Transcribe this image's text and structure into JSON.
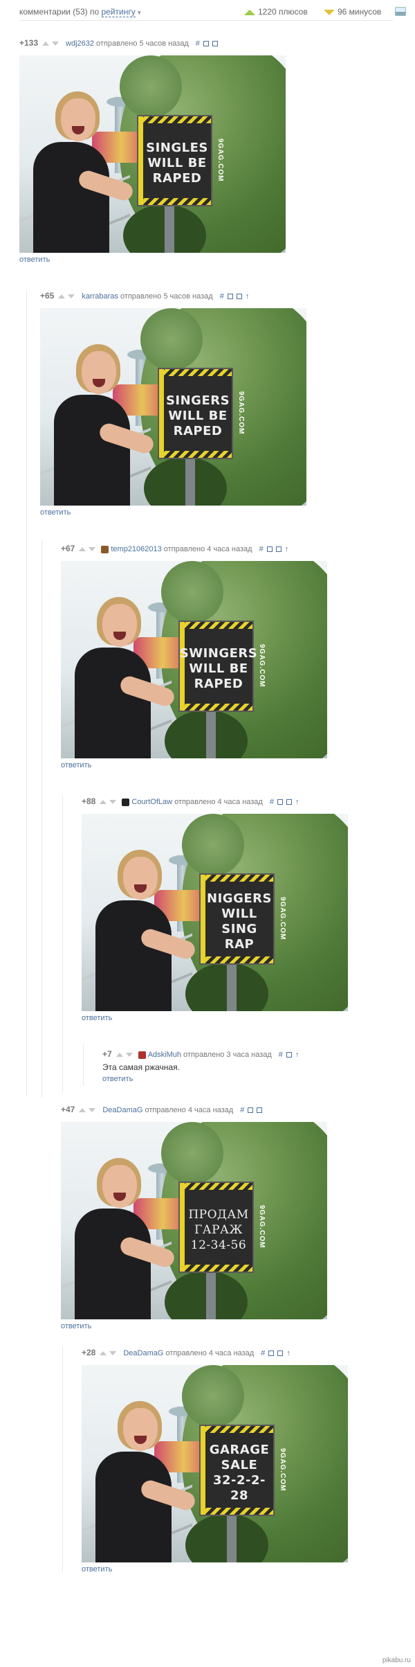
{
  "sort_bar": {
    "prefix": "комментарии (53) по",
    "sort_label": "рейтингу",
    "caret": "▾",
    "plus_text": "1220 плюсов",
    "minus_text": "96 минусов"
  },
  "common": {
    "sent": "отправлено",
    "reply": "ответить",
    "tools": "#",
    "arrow": "↑"
  },
  "comments": [
    {
      "rating": "+133",
      "author": "wdj2632",
      "time": "5 часов назад",
      "sign": [
        "SINGLES",
        "WILL BE",
        "RAPED"
      ],
      "watermark": "9GAG.COM",
      "avatar_color": ""
    },
    {
      "rating": "+65",
      "author": "karrabaras",
      "time": "5 часов назад",
      "sign": [
        "SINGERS",
        "WILL BE",
        "RAPED"
      ],
      "watermark": "9GAG.COM",
      "avatar_color": ""
    },
    {
      "rating": "+67",
      "author": "temp21062013",
      "time": "4 часа назад",
      "sign": [
        "SWINGERS",
        "WILL BE",
        "RAPED"
      ],
      "watermark": "9GAG.COM",
      "avatar_color": "#8a5a2b"
    },
    {
      "rating": "+88",
      "author": "CourtOfLaw",
      "time": "4 часа назад",
      "sign": [
        "NIGGERS",
        "WILL SING",
        "RAP"
      ],
      "watermark": "9GAG.COM",
      "avatar_color": "#222222"
    },
    {
      "rating": "+7",
      "author": "AdskiMuh",
      "time": "3 часа назад",
      "text": "Эта самая ржачная.",
      "avatar_color": "#b03030"
    },
    {
      "rating": "+47",
      "author": "DeaDamaG",
      "time": "4 часа назад",
      "sign": [
        "ПРОДАМ",
        "ГАРАЖ",
        "12-34-56"
      ],
      "watermark": "9GAG.COM",
      "avatar_color": ""
    },
    {
      "rating": "+28",
      "author": "DeaDamaG",
      "time": "4 часа назад",
      "sign": [
        "GARAGE",
        "SALE",
        "32-2-2-28"
      ],
      "watermark": "9GAG.COM",
      "avatar_color": ""
    }
  ],
  "footer": {
    "site": "pikabu.ru"
  },
  "colors": {
    "link": "#4a6f9c",
    "plus": "#9ccc45",
    "minus": "#e2c238"
  }
}
